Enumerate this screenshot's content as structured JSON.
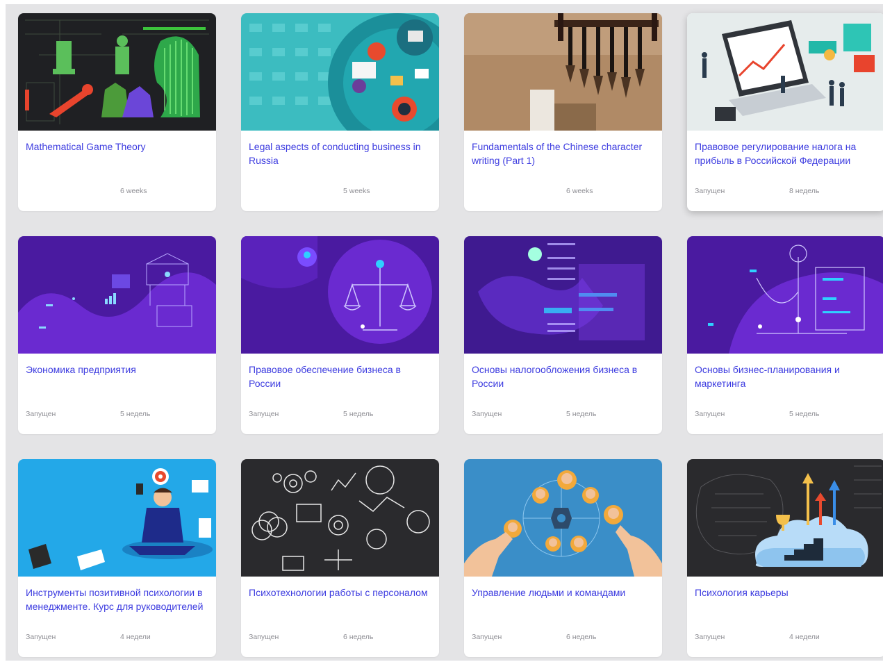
{
  "courses": [
    {
      "title": "Mathematical Game Theory",
      "status": "",
      "duration": "6 weeks"
    },
    {
      "title": "Legal aspects of conducting business in Russia",
      "status": "",
      "duration": "5 weeks"
    },
    {
      "title": "Fundamentals of the Chinese character writing (Part 1)",
      "status": "",
      "duration": "6 weeks"
    },
    {
      "title": "Правовое регулирование налога на прибыль в Российской Федерации",
      "status": "Запущен",
      "duration": "8 недель"
    },
    {
      "title": "Экономика предприятия",
      "status": "Запущен",
      "duration": "5 недель"
    },
    {
      "title": "Правовое обеспечение бизнеса в России",
      "status": "Запущен",
      "duration": "5 недель"
    },
    {
      "title": "Основы налогообложения бизнеса в России",
      "status": "Запущен",
      "duration": "5 недель"
    },
    {
      "title": "Основы бизнес-планирования и маркетинга",
      "status": "Запущен",
      "duration": "5 недель"
    },
    {
      "title": "Инструменты позитивной психологии в менеджменте. Курс для руководителей",
      "status": "Запущен",
      "duration": "4 недели"
    },
    {
      "title": "Психотехнологии работы с персоналом",
      "status": "Запущен",
      "duration": "6 недель"
    },
    {
      "title": "Управление людьми и командами",
      "status": "Запущен",
      "duration": "6 недель"
    },
    {
      "title": "Психология карьеры",
      "status": "Запущен",
      "duration": "4 недели"
    }
  ],
  "colors": {
    "title": "#3d3ce0",
    "meta": "#8d8d93",
    "background": "#e4e4e6"
  }
}
